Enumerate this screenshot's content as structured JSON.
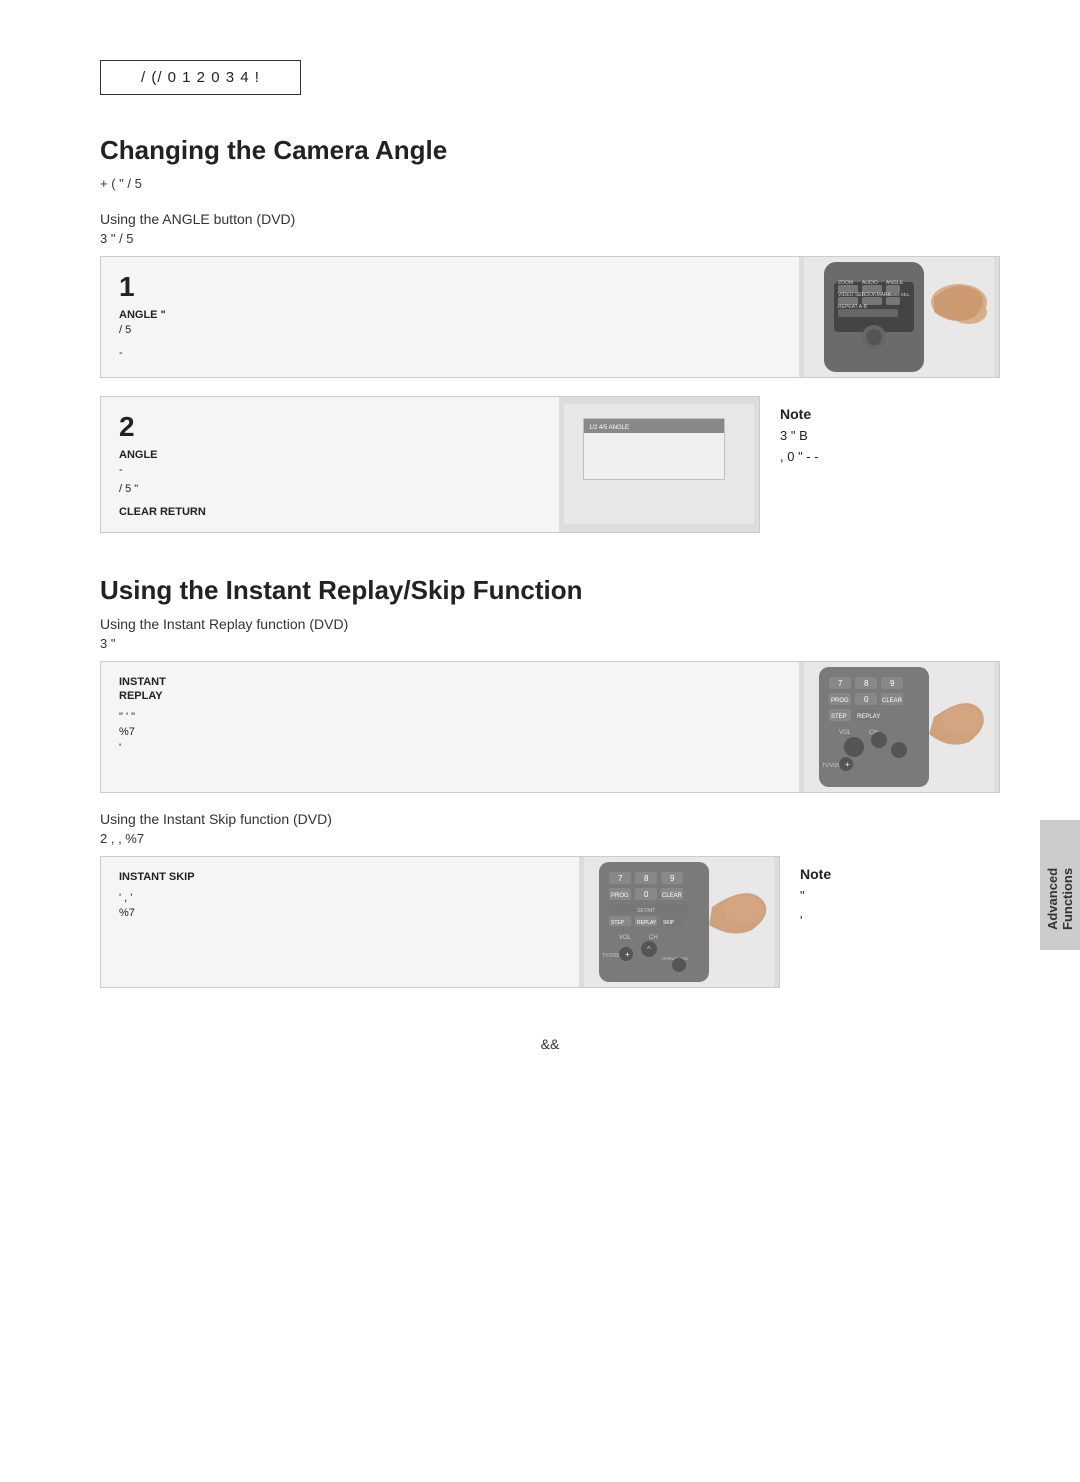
{
  "breadcrumb": {
    "text": "/ (/ 0     1 2 0 3 4 !"
  },
  "section1": {
    "title": "Changing the Camera Angle",
    "intro": "+  (                    \"         / 5",
    "subtitle": "Using the ANGLE button (DVD)",
    "subtitle_note": "3                 \"  / 5",
    "steps": [
      {
        "number": "1",
        "label": "ANGLE  \"",
        "text": "/ 5",
        "extra": "-"
      },
      {
        "number": "2",
        "label": "ANGLE",
        "text1": "-",
        "text2": "/ 5  \"",
        "text3": "CLEAR  RETURN"
      }
    ],
    "note_label": "Note",
    "note_text": "3              \"           B\n, 0   \" -    -"
  },
  "section2": {
    "title": "Using the Instant Replay/Skip Function",
    "subtitle1": "Using the Instant Replay function (DVD)",
    "subtitle1_note": "3          \"",
    "step_instant": {
      "label1": "INSTANT",
      "label2": "REPLAY",
      "text1": "\" '  \"",
      "text2": "%7",
      "text3": "'"
    },
    "subtitle2": "Using the Instant Skip function (DVD)",
    "subtitle2_note": "2          ,  ,   %7",
    "step_skip": {
      "label": "INSTANT SKIP",
      "text1": "' ,  '",
      "text2": "%7"
    },
    "note2_label": "Note",
    "note2_text": "\"",
    "note2_extra": "'"
  },
  "side_tab": {
    "line1": "Advanced",
    "line2": "Functions"
  },
  "page_number": "&&"
}
